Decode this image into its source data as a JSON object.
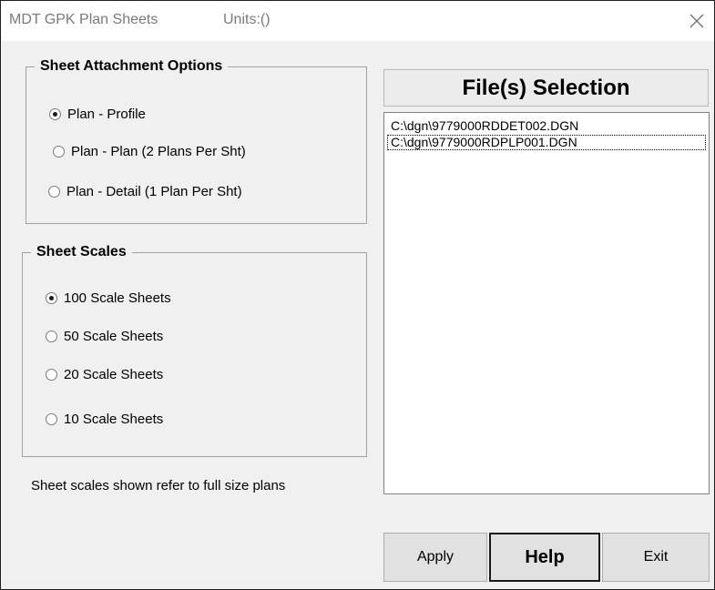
{
  "window": {
    "title": "MDT GPK Plan Sheets",
    "units_label": "Units:()"
  },
  "attachment": {
    "legend": "Sheet Attachment Options",
    "options": [
      {
        "label": "Plan - Profile",
        "selected": true
      },
      {
        "label": "Plan - Plan (2 Plans Per Sht)",
        "selected": false
      },
      {
        "label": "Plan - Detail (1 Plan Per Sht)",
        "selected": false
      }
    ]
  },
  "scales": {
    "legend": "Sheet Scales",
    "options": [
      {
        "label": "100 Scale Sheets",
        "selected": true
      },
      {
        "label": "50 Scale Sheets",
        "selected": false
      },
      {
        "label": "20 Scale Sheets",
        "selected": false
      },
      {
        "label": "10 Scale Sheets",
        "selected": false
      }
    ],
    "note": "Sheet scales shown refer to full size plans"
  },
  "files": {
    "header": "File(s) Selection",
    "items": [
      {
        "path": "C:\\dgn\\9779000RDDET002.DGN",
        "focused": false
      },
      {
        "path": "C:\\dgn\\9779000RDPLP001.DGN",
        "focused": true
      }
    ]
  },
  "buttons": {
    "apply": "Apply",
    "help": "Help",
    "exit": "Exit"
  },
  "icons": {
    "close": "close-icon",
    "radio": "radio-button-icon"
  }
}
